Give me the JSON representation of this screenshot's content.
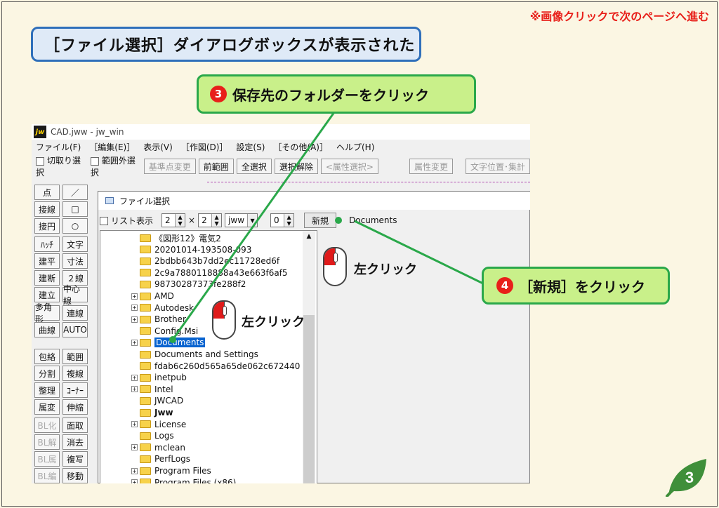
{
  "note": "※画像クリックで次のページへ進む",
  "heading": "［ファイル選択］ダイアログボックスが表示された",
  "callout3": {
    "num": "3",
    "text": "保存先のフォルダーをクリック"
  },
  "callout4": {
    "num": "4",
    "text": "［新規］をクリック"
  },
  "mouse_label": "左クリック",
  "page_number": "3",
  "app": {
    "title": "CAD.jww - jw_win",
    "menus": [
      "ファイル(F)",
      "［編集(E)］",
      "表示(V)",
      "［作図(D)］",
      "設定(S)",
      "［その他(A)］",
      "ヘルプ(H)"
    ],
    "toolbar": {
      "cut_select": "切取り選択",
      "out_of_range": "範囲外選択",
      "base_point": "基準点変更",
      "prev_range": "前範囲",
      "select_all": "全選択",
      "deselect": "選択解除",
      "attr_select": "<属性選択>",
      "attr_change": "属性変更",
      "text_pos": "文字位置･集計"
    },
    "side_left": [
      "点",
      "接線",
      "接円",
      "ﾊｯﾁ",
      "建平",
      "建断",
      "建立",
      "多角形",
      "曲線",
      "包絡",
      "分割",
      "整理",
      "属変",
      "BL化",
      "BL解",
      "BL属",
      "BL編"
    ],
    "side_right": [
      "／",
      "□",
      "○",
      "文字",
      "寸法",
      "２線",
      "中心線",
      "連線",
      "AUTO",
      "範囲",
      "複線",
      "ｺｰﾅｰ",
      "伸縮",
      "面取",
      "消去",
      "複写",
      "移動"
    ]
  },
  "dialog": {
    "title": "ファイル選択",
    "list_view": "リスト表示",
    "cols": "2",
    "times": "×",
    "rows": "2",
    "filetype": "jww",
    "num": "0",
    "new_button": "新規",
    "path": "Documents",
    "folders": [
      {
        "name": "《図形12》電気2",
        "expand": false,
        "bold": false,
        "selected": false
      },
      {
        "name": "20201014-193508-093",
        "expand": false,
        "bold": false,
        "selected": false
      },
      {
        "name": "2bdbb643b7dd2ec11728ed6f",
        "expand": false,
        "bold": false,
        "selected": false
      },
      {
        "name": "2c9a7880118888a43e663f6af5",
        "expand": false,
        "bold": false,
        "selected": false
      },
      {
        "name": "98730287373fe288f2",
        "expand": false,
        "bold": false,
        "selected": false
      },
      {
        "name": "AMD",
        "expand": true,
        "bold": false,
        "selected": false
      },
      {
        "name": "Autodesk",
        "expand": true,
        "bold": false,
        "selected": false
      },
      {
        "name": "Brother",
        "expand": true,
        "bold": false,
        "selected": false
      },
      {
        "name": "Config.Msi",
        "expand": false,
        "bold": false,
        "selected": false
      },
      {
        "name": "Documents",
        "expand": true,
        "bold": false,
        "selected": true
      },
      {
        "name": "Documents and Settings",
        "expand": false,
        "bold": false,
        "selected": false
      },
      {
        "name": "fdab6c260d565a65de062c672440",
        "expand": false,
        "bold": false,
        "selected": false
      },
      {
        "name": "inetpub",
        "expand": true,
        "bold": false,
        "selected": false
      },
      {
        "name": "Intel",
        "expand": true,
        "bold": false,
        "selected": false
      },
      {
        "name": "JWCAD",
        "expand": false,
        "bold": false,
        "selected": false
      },
      {
        "name": "Jww",
        "expand": false,
        "bold": true,
        "selected": false
      },
      {
        "name": "License",
        "expand": true,
        "bold": false,
        "selected": false
      },
      {
        "name": "Logs",
        "expand": false,
        "bold": false,
        "selected": false
      },
      {
        "name": "mclean",
        "expand": true,
        "bold": false,
        "selected": false
      },
      {
        "name": "PerfLogs",
        "expand": false,
        "bold": false,
        "selected": false
      },
      {
        "name": "Program Files",
        "expand": true,
        "bold": false,
        "selected": false
      },
      {
        "name": "Program Files (x86)",
        "expand": true,
        "bold": false,
        "selected": false
      }
    ]
  },
  "colors": {
    "accent_green": "#2aa84a",
    "callout_fill": "#c9f08a",
    "note_red": "#e8201a",
    "heading_border": "#2f6fba"
  }
}
